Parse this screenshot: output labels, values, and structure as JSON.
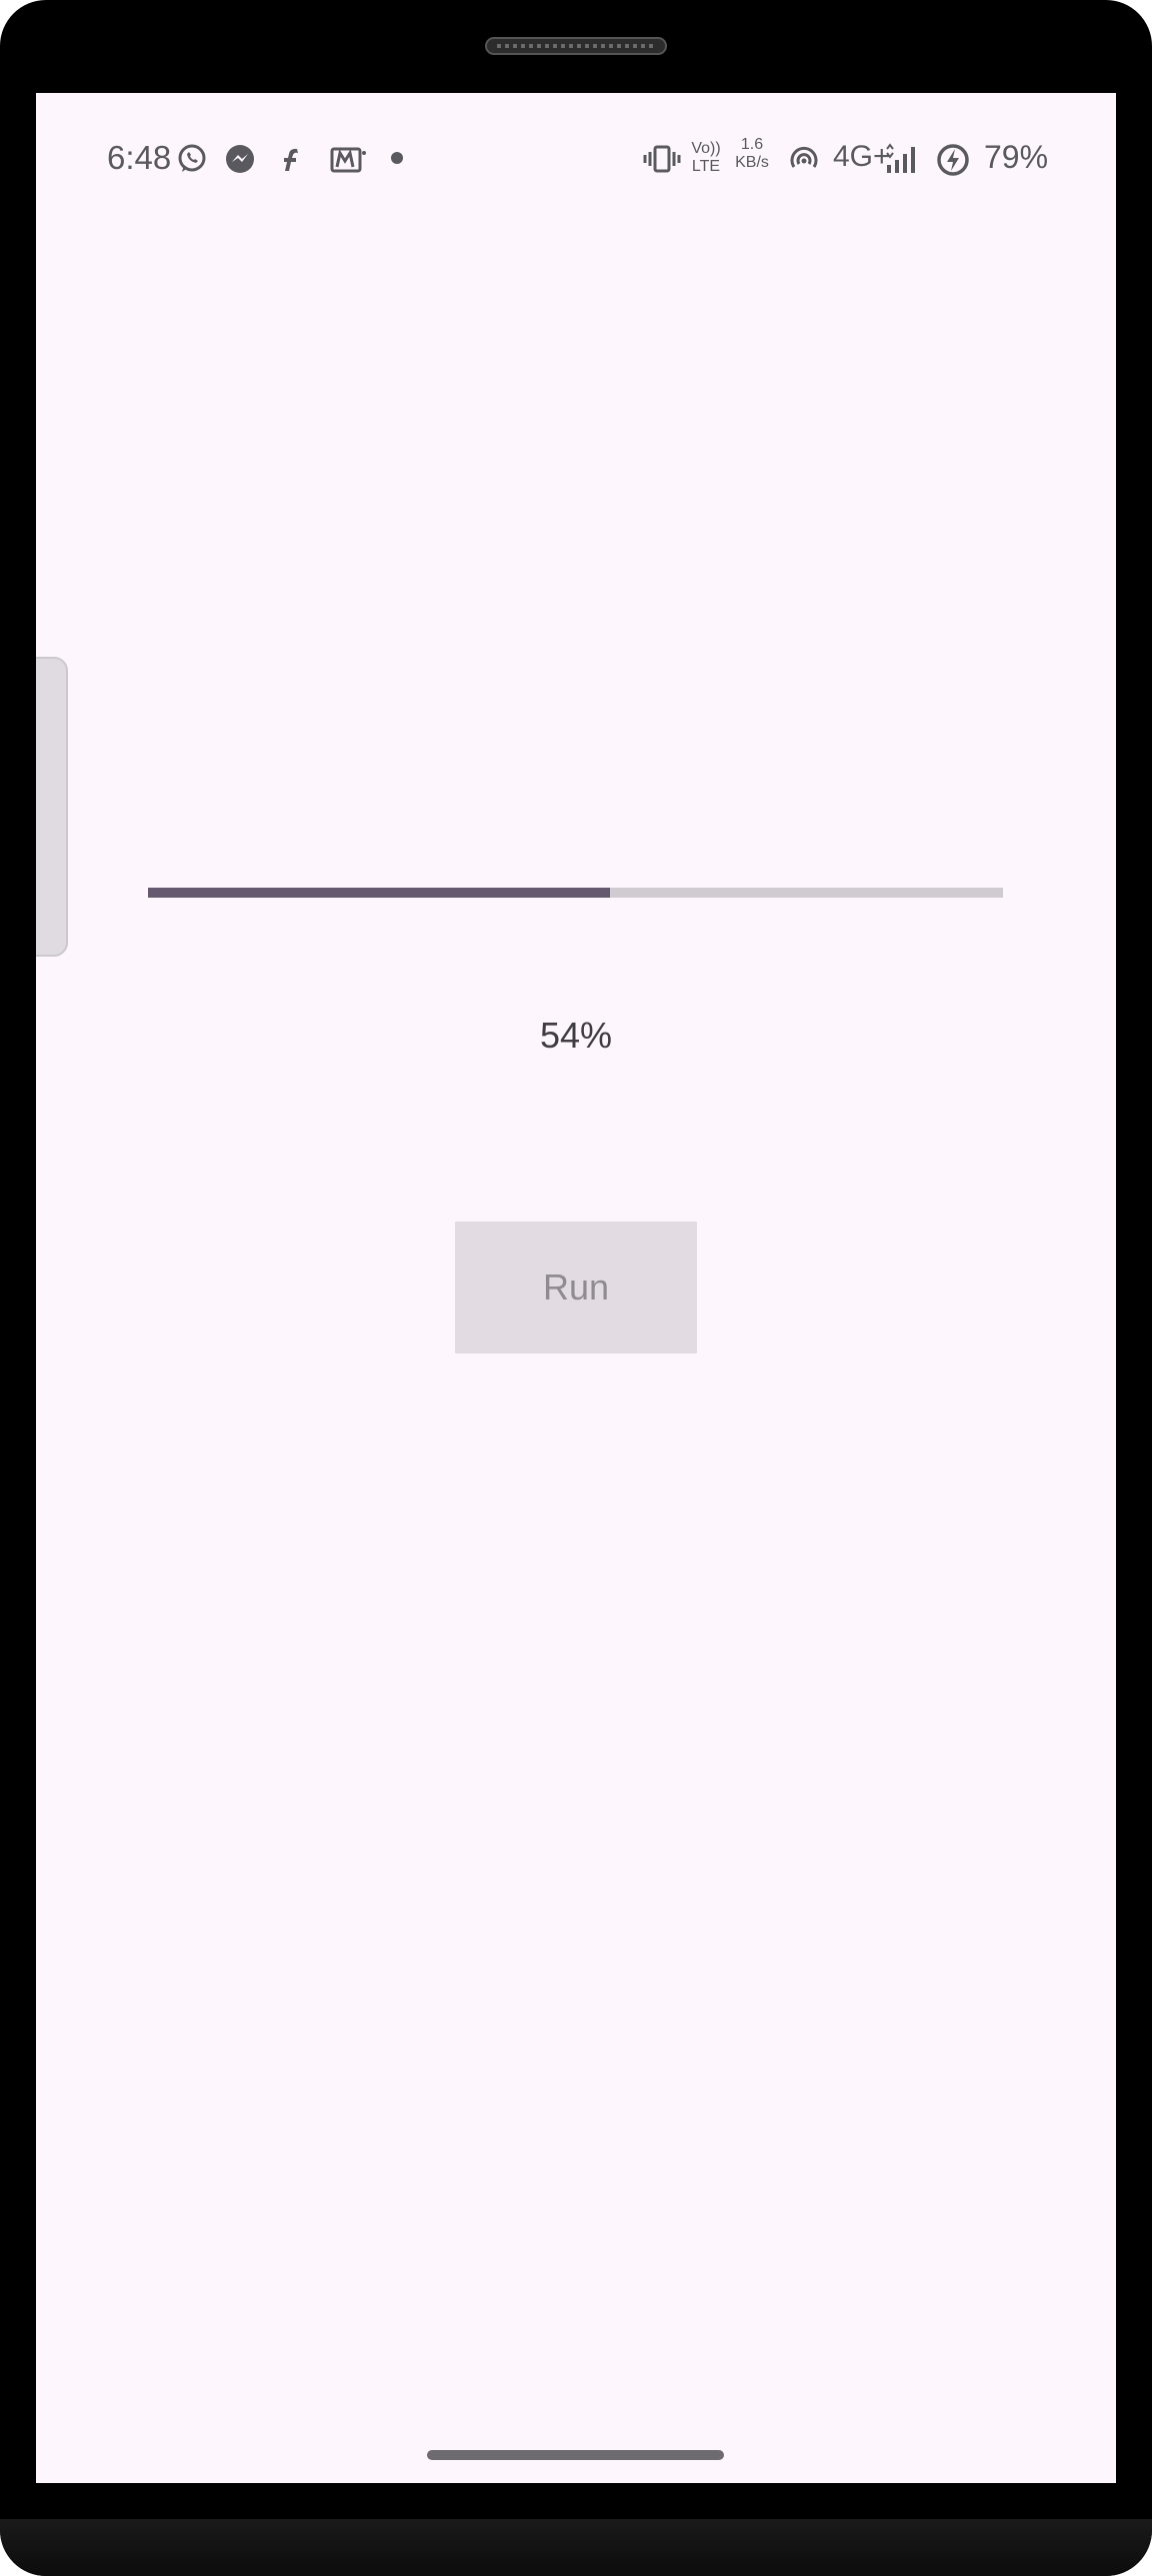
{
  "status_bar": {
    "time": "6:48",
    "notification_icons": [
      "whatsapp-icon",
      "messenger-icon",
      "flipkart-icon",
      "myjio-icon",
      "dot-icon"
    ],
    "volte_top": "Vo))",
    "volte_bottom": "LTE",
    "net_speed_value": "1.6",
    "net_speed_unit": "KB/s",
    "network_type": "4G+",
    "battery_percent": "79%",
    "system_icons": [
      "vibrate-icon",
      "hotspot-icon",
      "signal-icon",
      "battery-charging-icon"
    ]
  },
  "progress": {
    "value_fraction": 0.54,
    "label": "54%"
  },
  "run_button": {
    "label": "Run",
    "enabled": false
  },
  "colors": {
    "screen_background": "#fdf7fd",
    "progress_fill": "#65596f",
    "progress_track": "#d0cad1",
    "button_background": "#e2dbe2",
    "button_text": "#908a92"
  }
}
